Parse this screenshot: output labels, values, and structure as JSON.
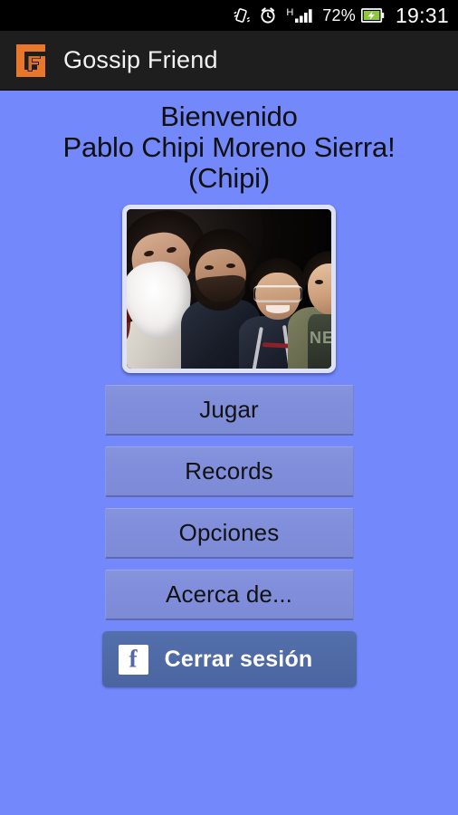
{
  "statusbar": {
    "vibrate_icon": "vibrate-icon",
    "alarm_icon": "alarm-clock-icon",
    "network_type": "H",
    "signal_icon": "signal-bars-icon",
    "battery_percent": "72%",
    "battery_icon": "battery-charging-icon",
    "clock": "19:31"
  },
  "actionbar": {
    "logo_icon": "gossip-friend-logo-icon",
    "title": "Gossip Friend"
  },
  "welcome": {
    "line1": "Bienvenido",
    "line2": "Pablo Chipi Moreno Sierra!",
    "line3": "(Chipi)"
  },
  "profile_photo": {
    "alt": "group-photo-four-men-night",
    "shirt_text": "NE"
  },
  "menu": {
    "buttons": [
      {
        "label": "Jugar",
        "name": "play-button"
      },
      {
        "label": "Records",
        "name": "records-button"
      },
      {
        "label": "Opciones",
        "name": "options-button"
      },
      {
        "label": "Acerca de...",
        "name": "about-button"
      }
    ]
  },
  "logout": {
    "label": "Cerrar sesión",
    "icon": "facebook-icon"
  },
  "colors": {
    "background": "#7288fb",
    "button": "#808edb",
    "actionbar": "#1e1e1e",
    "statusbar": "#000000",
    "facebook_blue": "#4f6aa5",
    "logo_orange": "#e8772a"
  }
}
